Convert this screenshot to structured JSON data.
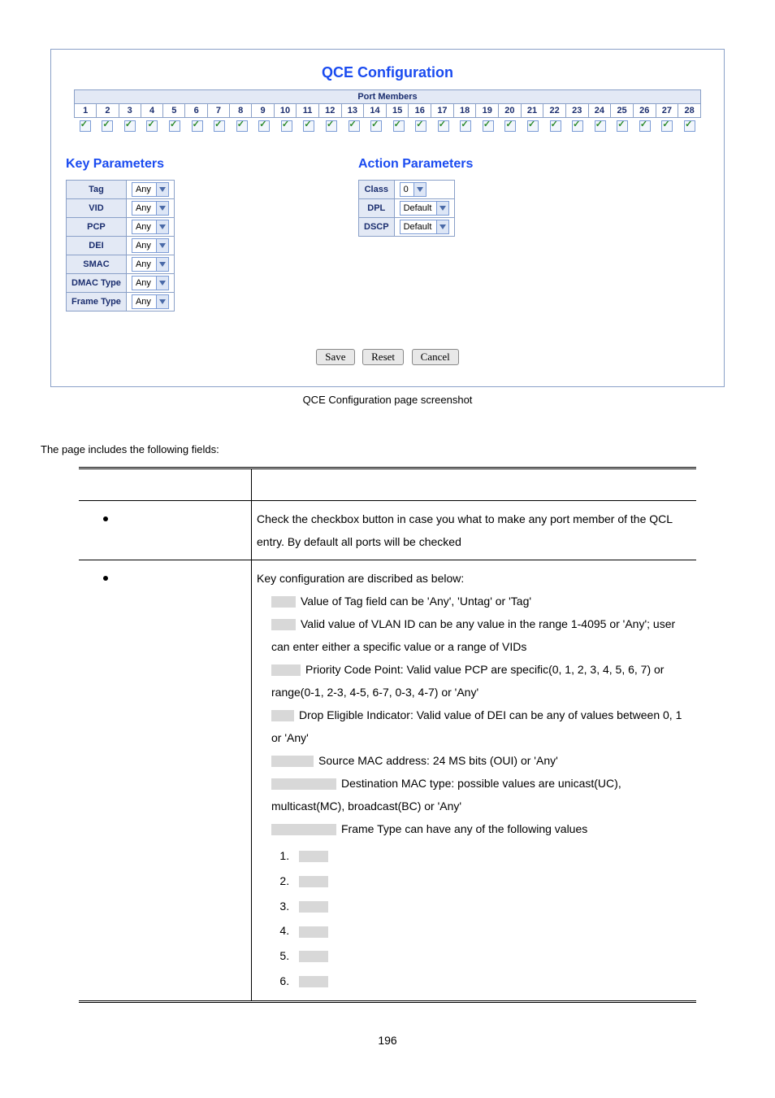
{
  "screenshot": {
    "title": "QCE Configuration",
    "port_members_label": "Port Members",
    "ports": [
      "1",
      "2",
      "3",
      "4",
      "5",
      "6",
      "7",
      "8",
      "9",
      "10",
      "11",
      "12",
      "13",
      "14",
      "15",
      "16",
      "17",
      "18",
      "19",
      "20",
      "21",
      "22",
      "23",
      "24",
      "25",
      "26",
      "27",
      "28"
    ],
    "key_params_title": "Key Parameters",
    "key_params": [
      {
        "label": "Tag",
        "value": "Any"
      },
      {
        "label": "VID",
        "value": "Any"
      },
      {
        "label": "PCP",
        "value": "Any"
      },
      {
        "label": "DEI",
        "value": "Any"
      },
      {
        "label": "SMAC",
        "value": "Any"
      },
      {
        "label": "DMAC Type",
        "value": "Any"
      },
      {
        "label": "Frame Type",
        "value": "Any"
      }
    ],
    "action_params_title": "Action Parameters",
    "action_params": [
      {
        "label": "Class",
        "value": "0"
      },
      {
        "label": "DPL",
        "value": "Default"
      },
      {
        "label": "DSCP",
        "value": "Default"
      }
    ],
    "buttons": {
      "save": "Save",
      "reset": "Reset",
      "cancel": "Cancel"
    }
  },
  "caption": "QCE Configuration page screenshot",
  "intro": "The page includes the following fields:",
  "rows": {
    "port_members": "Check the checkbox button in case you what to make any port member of the QCL entry. By default all ports will be checked",
    "key_intro": "Key configuration are discribed as below:",
    "tag": "Value of Tag field can be 'Any', 'Untag' or 'Tag'",
    "vid": "Valid value of VLAN ID can be any value in the range 1-4095 or 'Any'; user can enter either a specific value or a range of VIDs",
    "pcp": "Priority Code Point: Valid value PCP are specific(0, 1, 2, 3, 4, 5, 6, 7) or range(0-1, 2-3, 4-5, 6-7, 0-3, 4-7) or 'Any'",
    "dei": "Drop Eligible Indicator: Valid value of DEI can be any of values between 0, 1 or 'Any'",
    "smac": "Source MAC address: 24 MS bits (OUI) or 'Any'",
    "dmac": "Destination MAC type: possible values are unicast(UC), multicast(MC), broadcast(BC) or 'Any'",
    "frame": "Frame Type can have any of the following values",
    "ft_items": [
      "1.",
      "2.",
      "3.",
      "4.",
      "5.",
      "6."
    ]
  },
  "page_number": "196"
}
